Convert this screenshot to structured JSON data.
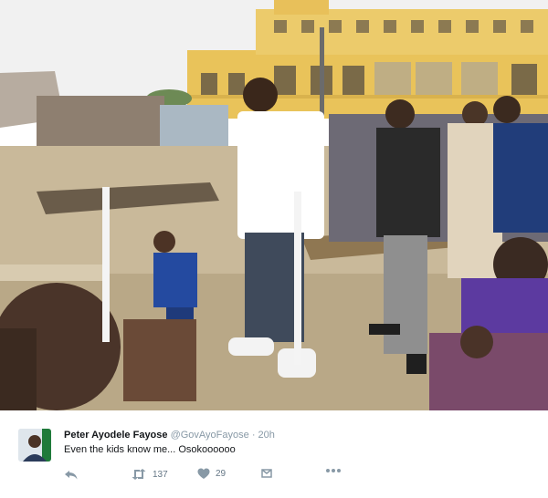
{
  "colors": {
    "sky": "#f1f1f1",
    "building": "#efc65a",
    "ground": "#c9b99a",
    "shirt": "#ffffff",
    "action_icon": "#8899a6"
  },
  "tweet": {
    "display_name": "Peter Ayodele Fayose",
    "handle": "@GovAyoFayose",
    "separator": "·",
    "time": "20h",
    "text": "Even the kids know me... Osokoooooo"
  },
  "actions": {
    "reply_icon": "reply-icon",
    "retweet_icon": "retweet-icon",
    "retweet_count": "137",
    "like_icon": "heart-icon",
    "like_count": "29",
    "dm_icon": "direct-message-icon",
    "more_icon": "more-icon"
  },
  "avatar": {
    "icon": "profile-avatar"
  }
}
